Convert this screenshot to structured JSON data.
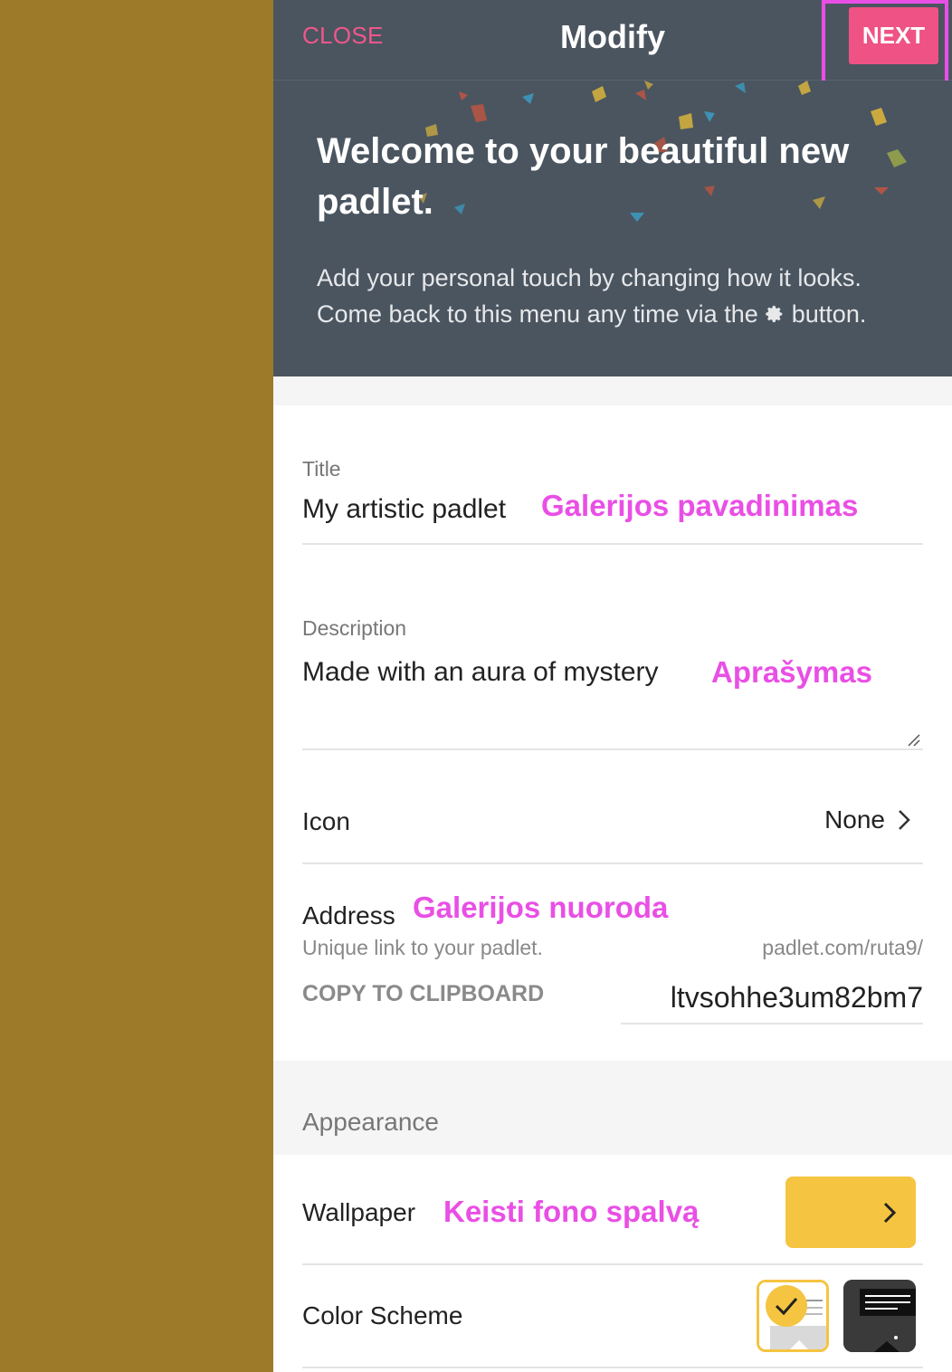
{
  "header": {
    "close_label": "CLOSE",
    "title": "Modify",
    "next_label": "NEXT"
  },
  "hero": {
    "title": "Welcome to your beautiful new padlet.",
    "desc_line1": "Add your personal touch by changing how it looks.",
    "desc_line2_before": "Come back to this menu any time via the",
    "desc_line2_after": "button."
  },
  "form": {
    "title_label": "Title",
    "title_value": "My artistic padlet",
    "title_annotation": "Galerijos pavadinimas",
    "description_label": "Description",
    "description_value": "Made with an aura of mystery",
    "description_annotation": "Aprašymas",
    "icon_label": "Icon",
    "icon_value": "None",
    "address_label": "Address",
    "address_annotation": "Galerijos nuoroda",
    "address_sub": "Unique link to your padlet.",
    "address_base": "padlet.com/ruta9/",
    "copy_label": "COPY TO CLIPBOARD",
    "address_slug": "ltvsohhe3um82bm7"
  },
  "appearance": {
    "section_label": "Appearance",
    "wallpaper_label": "Wallpaper",
    "wallpaper_annotation": "Keisti fono spalvą",
    "wallpaper_color": "#f5c441",
    "color_scheme_label": "Color Scheme",
    "selected_scheme": "light"
  },
  "colors": {
    "accent": "#ef5285",
    "annotation": "#e94fe5",
    "header_bg": "#4b5560",
    "page_bg": "#9c7a2a"
  }
}
